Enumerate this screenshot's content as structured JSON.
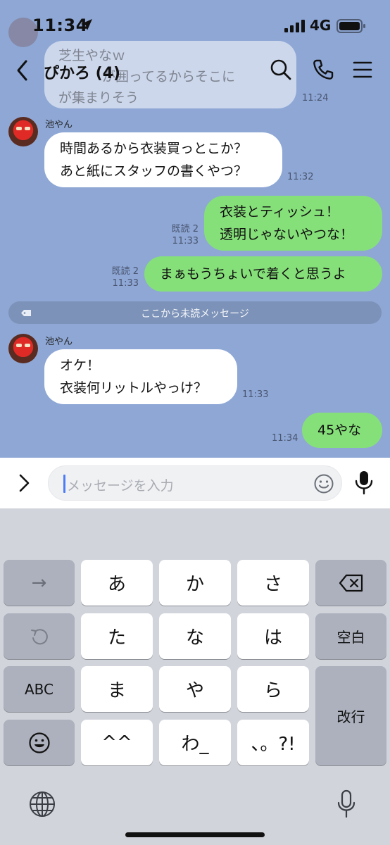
{
  "status": {
    "time": "11:34",
    "network": "4G"
  },
  "header": {
    "title": "ぴかろ (4)"
  },
  "previous": {
    "lines": [
      "芝生やなｗ",
      "が囲ってるからそこに",
      "が集まりそう"
    ],
    "time": "11:24"
  },
  "messages": [
    {
      "sender": "池やん",
      "lines": [
        "時間あるから衣装買っとこか？",
        "あと紙にスタッフの書くやつ？"
      ],
      "time": "11:32"
    },
    {
      "read": "既読 2",
      "lines": [
        "衣装とティッシュ！",
        "透明じゃないやつな！"
      ],
      "time": "11:33"
    },
    {
      "read": "既読 2",
      "lines": [
        "まぁもうちょいで着くと思うよ"
      ],
      "time": "11:33"
    },
    {
      "sender": "池やん",
      "lines": [
        "オケ！",
        "衣装何リットルやっけ？"
      ],
      "time": "11:33"
    },
    {
      "lines": [
        "45やな"
      ],
      "time": "11:34"
    }
  ],
  "unread_divider": "ここから未読メッセージ",
  "input": {
    "placeholder": "メッセージを入力"
  },
  "keyboard": {
    "arrow": "→",
    "keys": [
      "あ",
      "か",
      "さ",
      "た",
      "な",
      "は",
      "ま",
      "や",
      "ら",
      "^^",
      "わ_",
      "、。?!"
    ],
    "space": "空白",
    "abc": "ABC",
    "enter": "改行"
  },
  "colors": {
    "chat_bg": "#8ea7d5",
    "outgoing": "#86e07a",
    "incoming": "#ffffff"
  }
}
